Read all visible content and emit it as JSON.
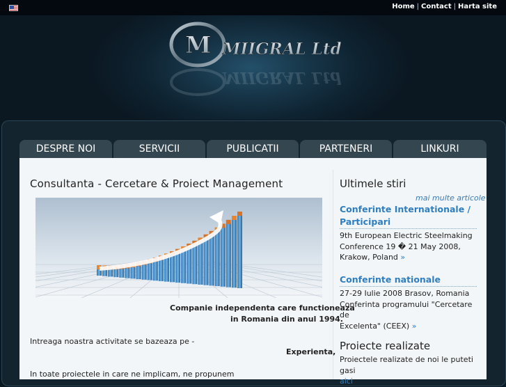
{
  "topbar": {
    "links": [
      "Home",
      "Contact",
      "Harta site"
    ],
    "separator": "|"
  },
  "logo": {
    "text": "MIIGRAL Ltd",
    "mark": "M"
  },
  "nav": {
    "tabs": [
      "DESPRE NOI",
      "SERVICII",
      "PUBLICATII",
      "PARTENERI",
      "LINKURI"
    ]
  },
  "main": {
    "title": "Consultanta - Cercetare & Proiect Management",
    "caption_line1": "Companie independenta care functioneaza",
    "caption_line2": "in Romania din anul 1994.",
    "para1": "Intreaga noastra activitate se bazeaza pe -",
    "para1_bold": "Experienta,",
    "para2": "In toate proiectele in care ne implicam, ne propunem"
  },
  "sidebar": {
    "news_title": "Ultimele stiri",
    "more_link": "mai multe articole",
    "news": [
      {
        "title_line1": "Conferinte Internationale /",
        "title_line2": "Participari",
        "text_line1": "9th European Electric Steelmaking",
        "text_line2": "Conference 19 � 21 May 2008,",
        "text_line3": "Krakow, Poland"
      },
      {
        "title_line1": "Conferinte nationale",
        "text_line1": "27-29 Iulie 2008 Brasov, Romania",
        "text_line2": "Conferinta programului \"Cercetare de",
        "text_line3": "Excelenta\" (CEEX)"
      }
    ],
    "raquo": "»",
    "projects_title": "Proiecte realizate",
    "projects_text": "Proiectele realizate de noi le puteti gasi",
    "projects_link": "aici",
    "projects_end": "."
  },
  "colors": {
    "tab_bg": "#34464f",
    "link": "#2f7ec0",
    "content_bg": "#f3f6f8"
  }
}
